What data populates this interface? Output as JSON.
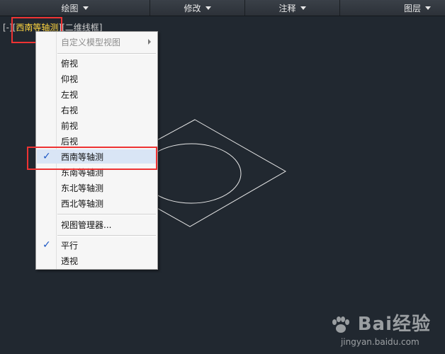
{
  "menubar": {
    "items": [
      {
        "label": "绘图"
      },
      {
        "label": "修改"
      },
      {
        "label": "注释"
      },
      {
        "label": "图层"
      }
    ]
  },
  "viewport": {
    "prefix": "[-][",
    "view_name": "西南等轴测",
    "mid": "][",
    "visual_style": "二维线框",
    "suffix": "]"
  },
  "context_menu": {
    "custom_views": "自定义模型视图",
    "views": [
      "俯视",
      "仰视",
      "左视",
      "右视",
      "前视",
      "后视"
    ],
    "iso_views": [
      "西南等轴测",
      "东南等轴测",
      "东北等轴测",
      "西北等轴测"
    ],
    "checked": "西南等轴测",
    "view_manager": "视图管理器...",
    "projection": [
      "平行",
      "透视"
    ],
    "projection_checked": "平行",
    "check_glyph": "✓"
  },
  "watermark": {
    "brand": "Bai经验",
    "url": "jingyan.baidu.com"
  }
}
